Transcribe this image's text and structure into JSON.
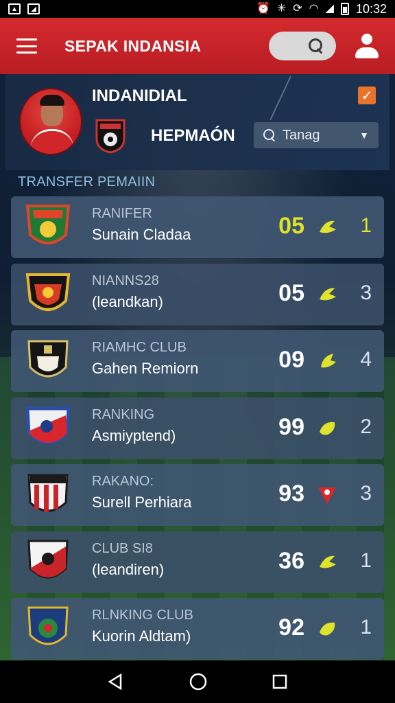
{
  "status_bar": {
    "time": "10:32"
  },
  "app_bar": {
    "title": "SEPAK INDANSIA"
  },
  "player": {
    "name": "INDANIDIAL",
    "club": "HEPMAÓN",
    "dropdown_value": "Tanag",
    "checked": true
  },
  "section": {
    "title": "TRANSFER PEMAIIN"
  },
  "rows": [
    {
      "label": "RANIFER",
      "name": "Sunain Cladaa",
      "score": "05",
      "count": "1",
      "highlight": true
    },
    {
      "label": "NIANNS28",
      "name": "(leandkan)",
      "score": "05",
      "count": "3",
      "highlight": false
    },
    {
      "label": "RIAMHC CLUB",
      "name": "Gahen Remiorn",
      "score": "09",
      "count": "4",
      "highlight": false
    },
    {
      "label": "RANKING",
      "name": "Asmiyptend)",
      "score": "99",
      "count": "2",
      "highlight": false
    },
    {
      "label": "RAKANO:",
      "name": "Surell Perhiara",
      "score": "93",
      "count": "3",
      "highlight": false
    },
    {
      "label": "CLUB SI8",
      "name": "(leandiren)",
      "score": "36",
      "count": "1",
      "highlight": false
    },
    {
      "label": "RLNKING CLUB",
      "name": "Kuorin Aldtam)",
      "score": "92",
      "count": "1",
      "highlight": false
    }
  ],
  "colors": {
    "accent": "#d42a2f",
    "highlight": "#dfe32c",
    "checkbox": "#e8732a"
  },
  "icons": [
    "menu-icon",
    "search-icon",
    "profile-icon",
    "checkbox-icon",
    "club-crest-icon",
    "search-icon",
    "chevron-down-icon",
    "kick-icon",
    "back-icon",
    "home-icon",
    "recent-apps-icon"
  ]
}
